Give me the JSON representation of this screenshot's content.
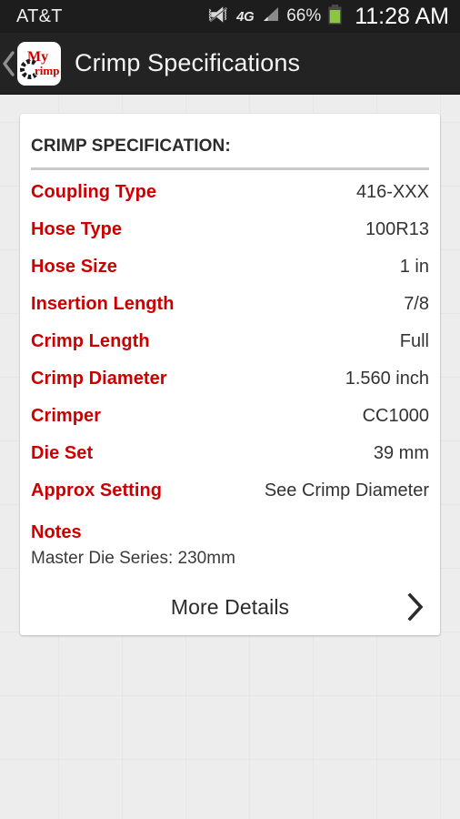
{
  "status_bar": {
    "carrier": "AT&T",
    "network_type": "4G",
    "battery_percent": "66%",
    "clock": "11:28 AM",
    "icons": {
      "vibrate_muted": "vibrate-muted-icon",
      "signal": "signal-bars-icon",
      "battery": "battery-icon"
    },
    "colors": {
      "background": "#1d1d1d",
      "text": "#f2f2f2",
      "battery_fill": "#8cc63f"
    }
  },
  "action_bar": {
    "back_label": "‹",
    "logo_top_text": "My",
    "logo_bottom_text": "rimp",
    "title": "Crimp Specifications",
    "colors": {
      "background": "#232323",
      "title": "#f4f4f4",
      "logo_red": "#cc0000"
    }
  },
  "card": {
    "title": "CRIMP SPECIFICATION:",
    "specs": [
      {
        "label": "Coupling Type",
        "value": "416-XXX"
      },
      {
        "label": "Hose Type",
        "value": "100R13"
      },
      {
        "label": "Hose Size",
        "value": "1 in"
      },
      {
        "label": "Insertion Length",
        "value": "7/8"
      },
      {
        "label": "Crimp Length",
        "value": "Full"
      },
      {
        "label": "Crimp Diameter",
        "value": "1.560 inch"
      },
      {
        "label": "Crimper",
        "value": "CC1000"
      },
      {
        "label": "Die Set",
        "value": "39 mm"
      },
      {
        "label": "Approx Setting",
        "value": "See Crimp Diameter"
      }
    ],
    "notes": {
      "label": "Notes",
      "value": "Master Die Series:  230mm"
    },
    "more_details": {
      "label": "More Details",
      "chevron": "chevron-right-icon"
    },
    "colors": {
      "background": "#ffffff",
      "label": "#cc0000",
      "value": "#333333",
      "divider": "#c9c9c9"
    }
  },
  "page": {
    "background": "#ededed"
  }
}
